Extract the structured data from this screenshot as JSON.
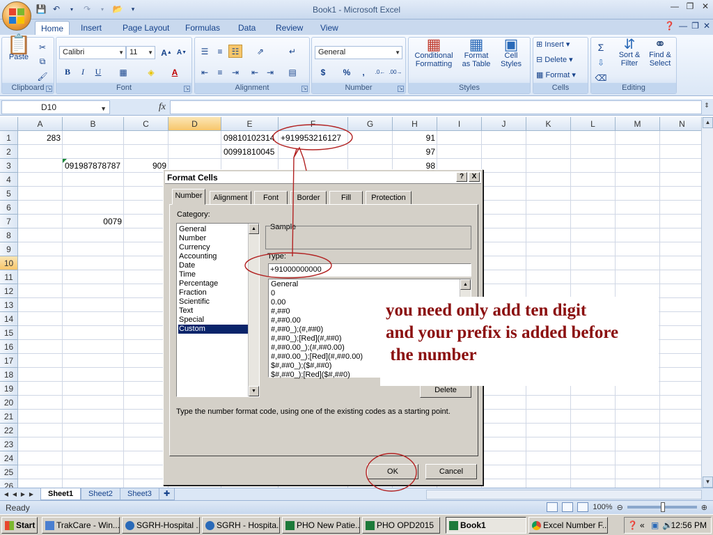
{
  "window": {
    "title": "Book1 - Microsoft Excel"
  },
  "ribbon": {
    "tabs": [
      "Home",
      "Insert",
      "Page Layout",
      "Formulas",
      "Data",
      "Review",
      "View"
    ],
    "clipboard": {
      "label": "Clipboard",
      "paste": "Paste"
    },
    "font": {
      "label": "Font",
      "name": "Calibri",
      "size": "11"
    },
    "alignment": {
      "label": "Alignment"
    },
    "number": {
      "label": "Number",
      "format": "General"
    },
    "styles": {
      "label": "Styles",
      "conditional": "Conditional\nFormatting",
      "format_table": "Format\nas Table",
      "cell_styles": "Cell\nStyles"
    },
    "cells": {
      "label": "Cells",
      "insert": "Insert",
      "delete": "Delete",
      "format": "Format"
    },
    "editing": {
      "label": "Editing",
      "sort": "Sort &\nFilter",
      "find": "Find &\nSelect"
    }
  },
  "formula_bar": {
    "name_box": "D10",
    "fx": "fx"
  },
  "grid": {
    "columns": [
      "A",
      "B",
      "C",
      "D",
      "E",
      "F",
      "G",
      "H",
      "I",
      "J",
      "K",
      "L",
      "M",
      "N"
    ],
    "rows": [
      "1",
      "2",
      "3",
      "4",
      "5",
      "6",
      "7",
      "8",
      "9",
      "10",
      "11",
      "12",
      "13",
      "14",
      "15",
      "16",
      "17",
      "18",
      "19",
      "20",
      "21",
      "22",
      "23",
      "24",
      "25",
      "26"
    ],
    "cells": {
      "A1": "283",
      "E1": "09810102314",
      "F1": "+919953216127",
      "H1": "91",
      "E2": "00991810045",
      "H2": "97",
      "B3": "091987878787",
      "C3": "909",
      "H3": "98",
      "B7": "0079"
    }
  },
  "sheets": [
    "Sheet1",
    "Sheet2",
    "Sheet3"
  ],
  "status": {
    "text": "Ready",
    "zoom": "100%"
  },
  "dialog": {
    "title": "Format Cells",
    "help_btn": "?",
    "close_btn": "X",
    "tabs": [
      "Number",
      "Alignment",
      "Font",
      "Border",
      "Fill",
      "Protection"
    ],
    "category_label": "Category:",
    "categories": [
      "General",
      "Number",
      "Currency",
      "Accounting",
      "Date",
      "Time",
      "Percentage",
      "Fraction",
      "Scientific",
      "Text",
      "Special",
      "Custom"
    ],
    "selected_category": "Custom",
    "sample_label": "Sample",
    "type_label": "Type:",
    "type_value": "+91000000000",
    "type_list": [
      "General",
      "0",
      "0.00",
      "#,##0",
      "#,##0.00",
      "#,##0_);(#,##0)",
      "#,##0_);[Red](#,##0)",
      "#,##0.00_);(#,##0.00)",
      "#,##0.00_);[Red](#,##0.00)",
      "$#,##0_);($#,##0)",
      "$#,##0_);[Red]($#,##0)"
    ],
    "delete_btn": "Delete",
    "description": "Type the number format code, using one of the existing codes as a starting point.",
    "ok_btn": "OK",
    "cancel_btn": "Cancel"
  },
  "annotation": {
    "text": "you need only add ten digit\nand your prefix is added before\n the number",
    "color": "#8b0f0f"
  },
  "taskbar": {
    "start": "Start",
    "items": [
      "TrakCare - Win...",
      "SGRH-Hospital ...",
      "SGRH - Hospita...",
      "PHO New Patie...",
      "PHO OPD2015",
      "Book1",
      "Excel Number F..."
    ],
    "active": "Book1",
    "clock": "12:56 PM"
  }
}
